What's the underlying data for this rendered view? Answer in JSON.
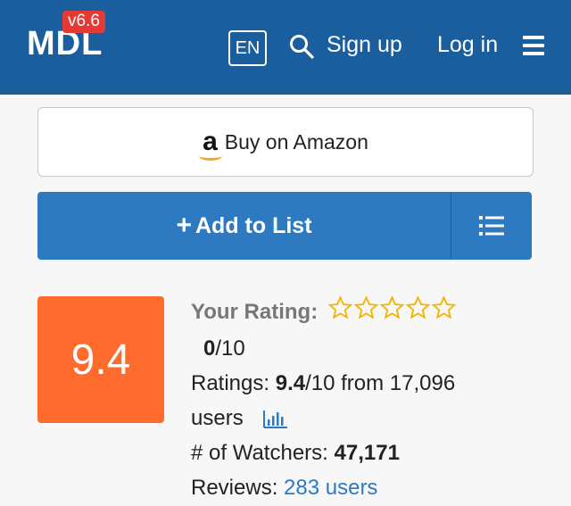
{
  "header": {
    "logo": "MDL",
    "version": "v6.6",
    "language": "EN",
    "signup_label": "Sign up",
    "login_label": "Log in"
  },
  "amazon": {
    "label": "Buy on Amazon",
    "logo_letter": "a"
  },
  "add_to_list": {
    "label": "Add to List",
    "plus": "+"
  },
  "rating": {
    "score": "9.4",
    "your_rating_label": "Your Rating:",
    "your_rating_value": "0",
    "your_rating_max": "/10",
    "stars_count": 5,
    "ratings_label": "Ratings:",
    "ratings_value": "9.4",
    "ratings_rest": "/10 from 17,096",
    "ratings_users": "users",
    "watchers_label": "# of Watchers:",
    "watchers_value": "47,171",
    "reviews_label": "Reviews:",
    "reviews_value": "283 users"
  },
  "colors": {
    "header_bg": "#1b5e9d",
    "version_badge": "#e53935",
    "add_button": "#2d7ac1",
    "score_box": "#ff6b2c",
    "star_outline": "#f5b400",
    "link": "#2d7ac1"
  }
}
